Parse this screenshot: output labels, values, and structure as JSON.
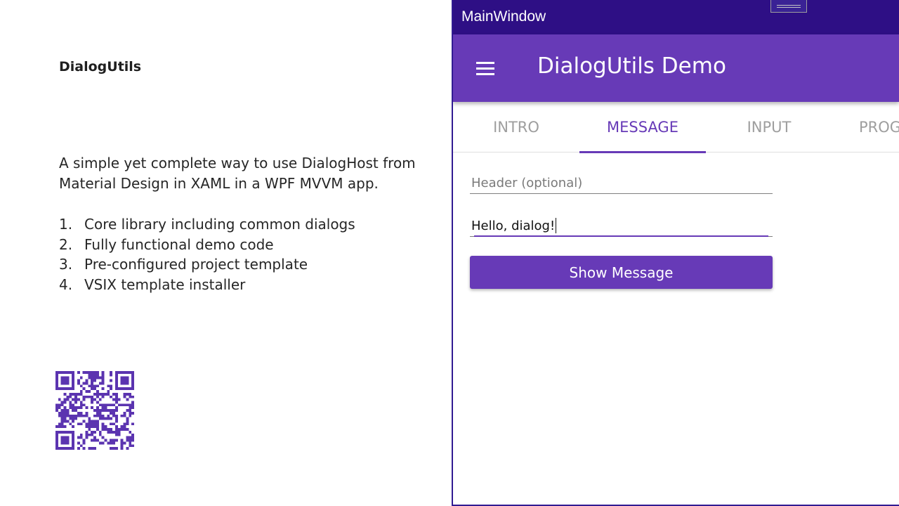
{
  "slide": {
    "title": "DialogUtils",
    "description": "A simple yet complete way to use DialogHost from Material Design in XAML in a WPF MVVM app.",
    "features": [
      {
        "num": "1.",
        "text": "Core library including common dialogs"
      },
      {
        "num": "2.",
        "text": "Fully functional demo code"
      },
      {
        "num": "3.",
        "text": "Pre-configured project template"
      },
      {
        "num": "4.",
        "text": "VSIX template installer"
      }
    ],
    "qr_icon": "qr-code-icon"
  },
  "window": {
    "title": "MainWindow"
  },
  "app_bar": {
    "menu_icon": "hamburger-menu-icon",
    "title": "DialogUtils Demo"
  },
  "tabs": [
    {
      "label": "INTRO",
      "active": false
    },
    {
      "label": "MESSAGE",
      "active": true
    },
    {
      "label": "INPUT",
      "active": false
    },
    {
      "label": "PROGRESS",
      "active": false
    }
  ],
  "form": {
    "header_placeholder": "Header (optional)",
    "header_value": "",
    "message_value": "Hello, dialog!",
    "submit_label": "Show Message"
  },
  "colors": {
    "accent": "#673ab7",
    "title_bar": "#2e0f85",
    "qr": "#5b34b0"
  }
}
